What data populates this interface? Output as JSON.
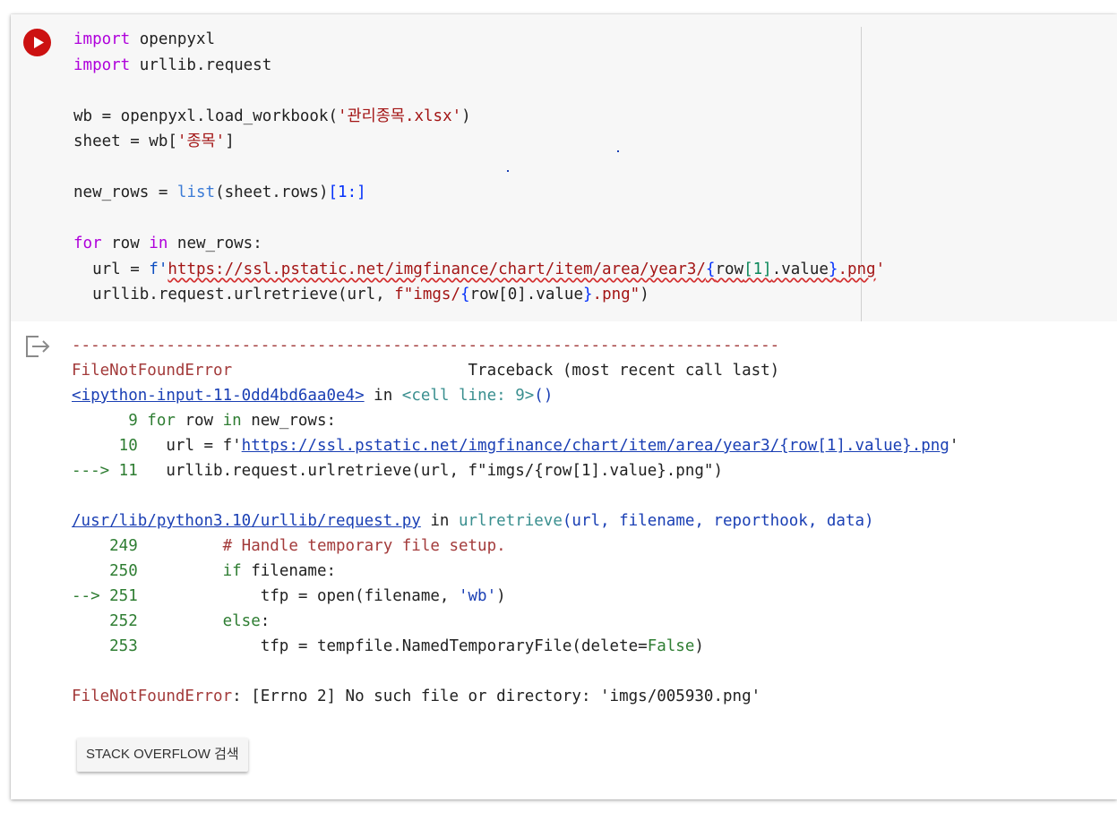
{
  "code_lines": [
    [
      {
        "t": "import",
        "c": "kw"
      },
      {
        "t": " openpyxl"
      }
    ],
    [
      {
        "t": "import",
        "c": "kw"
      },
      {
        "t": " urllib.request"
      }
    ],
    [],
    [
      {
        "t": "wb = openpyxl.load_workbook("
      },
      {
        "t": "'관리종목.xlsx'",
        "c": "str"
      },
      {
        "t": ")"
      }
    ],
    [
      {
        "t": "sheet = wb["
      },
      {
        "t": "'종목'",
        "c": "str"
      },
      {
        "t": "]"
      }
    ],
    [],
    [
      {
        "t": "new_rows = "
      },
      {
        "t": "list",
        "c": "fn"
      },
      {
        "t": "(sheet.rows)"
      },
      {
        "t": "[1:]",
        "c": "br"
      }
    ],
    [],
    [
      {
        "t": "for",
        "c": "kw"
      },
      {
        "t": " row "
      },
      {
        "t": "in",
        "c": "kw"
      },
      {
        "t": " new_rows:"
      }
    ],
    [
      {
        "t": "  url = "
      },
      {
        "t": "f'",
        "c": "kwb"
      },
      {
        "t": "https://ssl.pstatic.net/imgfinance/chart/item/area/year3/",
        "c": "str",
        "u": true
      },
      {
        "t": "{",
        "c": "br",
        "u": true
      },
      {
        "t": "row",
        "u": true
      },
      {
        "t": "[1]",
        "c": "num",
        "u": true
      },
      {
        "t": ".value",
        "u": true
      },
      {
        "t": "}",
        "c": "br",
        "u": true
      },
      {
        "t": ".png",
        "c": "str",
        "u": true
      },
      {
        "t": "'",
        "c": "str"
      }
    ],
    [
      {
        "t": "  urllib.request.urlretrieve(url, "
      },
      {
        "t": "f\"imgs/",
        "c": "str"
      },
      {
        "t": "{",
        "c": "br"
      },
      {
        "t": "row[0].value"
      },
      {
        "t": "}",
        "c": "br"
      },
      {
        "t": ".png\"",
        "c": "str"
      },
      {
        "t": ")"
      }
    ]
  ],
  "output_lines": [
    [
      {
        "t": "---------------------------------------------------------------------------",
        "c": "red"
      }
    ],
    [
      {
        "t": "FileNotFoundError",
        "c": "red"
      },
      {
        "t": "                         Traceback (most recent call last)"
      }
    ],
    [
      {
        "t": "<ipython-input-11-0dd4bd6aa0e4>",
        "c": "lnk"
      },
      {
        "t": " in "
      },
      {
        "t": "<cell line: 9>",
        "c": "teal"
      },
      {
        "t": "()",
        "c": "blue"
      }
    ],
    [
      {
        "t": "      9 ",
        "c": "green"
      },
      {
        "t": "for",
        "c": "green"
      },
      {
        "t": " row "
      },
      {
        "t": "in",
        "c": "green"
      },
      {
        "t": " new_rows:"
      }
    ],
    [
      {
        "t": "     10 ",
        "c": "green"
      },
      {
        "t": "  url = f'"
      },
      {
        "t": "https://ssl.pstatic.net/imgfinance/chart/item/area/year3/{row[1].value}.png",
        "c": "lnk"
      },
      {
        "t": "'"
      }
    ],
    [
      {
        "t": "---> 11 ",
        "c": "green"
      },
      {
        "t": "  urllib.request.urlretrieve(url, f\"imgs/{row[1].value}.png\")"
      }
    ],
    [],
    [
      {
        "t": "/usr/lib/python3.10/urllib/request.py",
        "c": "lnk"
      },
      {
        "t": " in "
      },
      {
        "t": "urlretrieve",
        "c": "teal"
      },
      {
        "t": "(url, filename, reporthook, data)",
        "c": "blue"
      }
    ],
    [
      {
        "t": "    249 ",
        "c": "green"
      },
      {
        "t": "        # Handle temporary file setup.",
        "c": "red"
      }
    ],
    [
      {
        "t": "    250 ",
        "c": "green"
      },
      {
        "t": "        "
      },
      {
        "t": "if",
        "c": "green"
      },
      {
        "t": " filename:"
      }
    ],
    [
      {
        "t": "--> 251 ",
        "c": "green"
      },
      {
        "t": "            tfp = open(filename, "
      },
      {
        "t": "'wb'",
        "c": "blue"
      },
      {
        "t": ")"
      }
    ],
    [
      {
        "t": "    252 ",
        "c": "green"
      },
      {
        "t": "        "
      },
      {
        "t": "else",
        "c": "green"
      },
      {
        "t": ":"
      }
    ],
    [
      {
        "t": "    253 ",
        "c": "green"
      },
      {
        "t": "            tfp = tempfile.NamedTemporaryFile(delete="
      },
      {
        "t": "False",
        "c": "green"
      },
      {
        "t": ")"
      }
    ],
    [],
    [
      {
        "t": "FileNotFoundError",
        "c": "red"
      },
      {
        "t": ": [Errno 2] No such file or directory: 'imgs/005930.png'"
      }
    ]
  ],
  "stackoverflow_button": "STACK OVERFLOW 검색",
  "icons": {
    "run": "play-circle-icon",
    "output": "output-exit-icon"
  },
  "colors": {
    "run_button": "#cc1111",
    "error_text": "#a33b3b",
    "line_numbers": "#2e7d32",
    "link": "#1a3fb4"
  }
}
